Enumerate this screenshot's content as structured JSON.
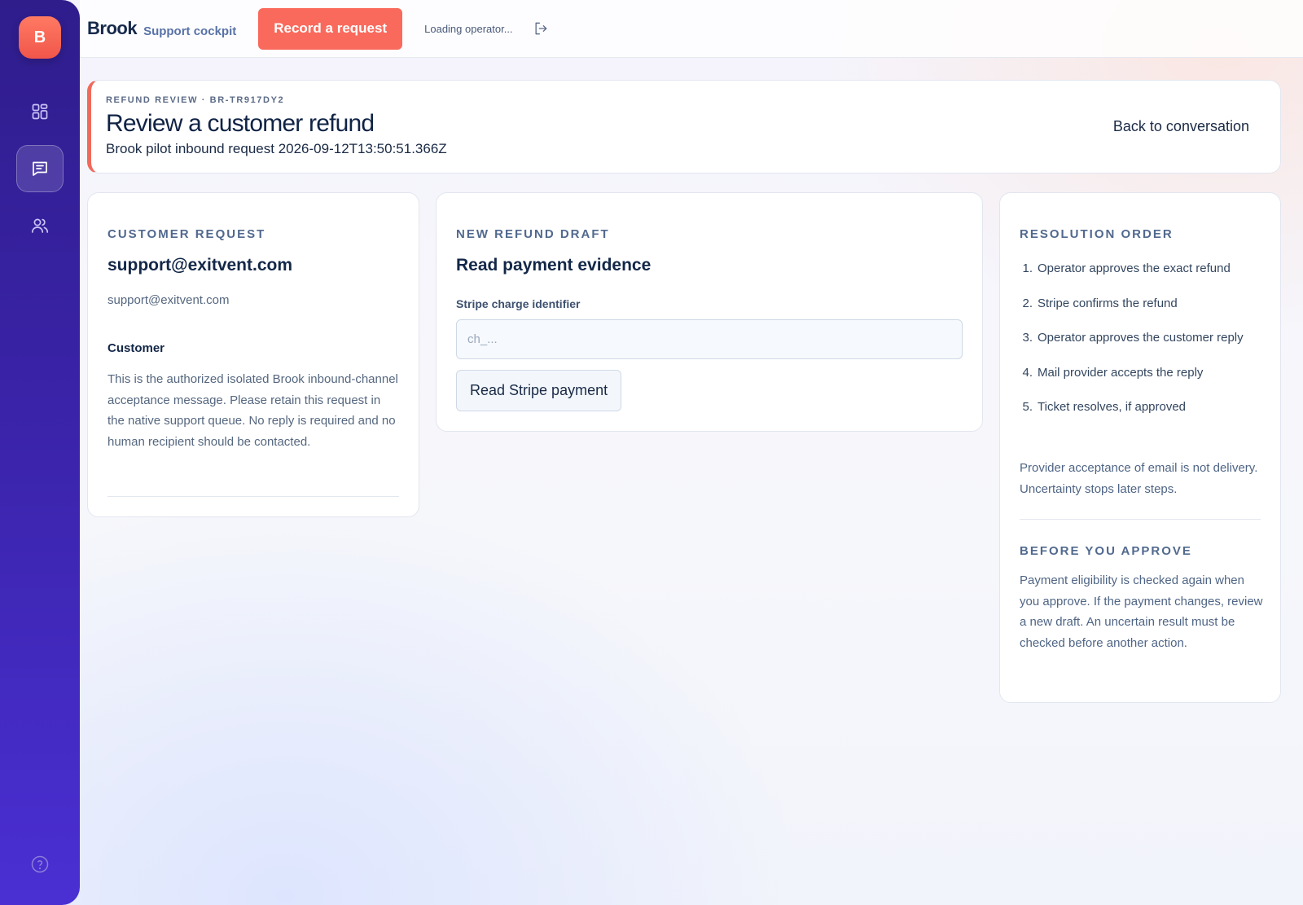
{
  "sidebar": {
    "logo_letter": "B",
    "nav": [
      {
        "icon": "dashboard-grid-icon"
      },
      {
        "icon": "conversation-icon",
        "active": true
      },
      {
        "icon": "people-icon"
      }
    ],
    "help_icon": "help-circle-icon"
  },
  "topbar": {
    "brand": "Brook",
    "brand_sub": "Support cockpit",
    "record_button": "Record a request",
    "operator_status": "Loading operator...",
    "logout_icon": "logout-icon"
  },
  "header": {
    "kicker": "REFUND REVIEW · BR-TR917DY2",
    "title": "Review a customer refund",
    "subtitle": "Brook pilot inbound request 2026-09-12T13:50:51.366Z",
    "back_link": "Back to conversation"
  },
  "request": {
    "section": "CUSTOMER REQUEST",
    "title": "support@exitvent.com",
    "email": "support@exitvent.com",
    "customer_label": "Customer",
    "body": "This is the authorized isolated Brook inbound-channel acceptance message. Please retain this request in the native support queue. No reply is required and no human recipient should be contacted."
  },
  "draft": {
    "section": "NEW REFUND DRAFT",
    "title": "Read payment evidence",
    "field_label": "Stripe charge identifier",
    "field_placeholder": "ch_...",
    "field_value": "",
    "button": "Read Stripe payment"
  },
  "order": {
    "section": "RESOLUTION ORDER",
    "steps": [
      {
        "num": "1.",
        "text": "Operator approves the exact refund"
      },
      {
        "num": "2.",
        "text": "Stripe confirms the refund"
      },
      {
        "num": "3.",
        "text": "Operator approves the customer reply"
      },
      {
        "num": "4.",
        "text": "Mail provider accepts the reply"
      },
      {
        "num": "5.",
        "text": "Ticket resolves, if approved"
      }
    ],
    "note": "Provider acceptance of email is not delivery. Uncertainty stops later steps.",
    "approve_section": "BEFORE YOU APPROVE",
    "approve_body": "Payment eligibility is checked again when you approve. If the payment changes, review a new draft. An uncertain result must be checked before another action."
  },
  "colors": {
    "accent": "#f96a5c",
    "sidebar": "#3a23a8",
    "text": "#16294a"
  }
}
